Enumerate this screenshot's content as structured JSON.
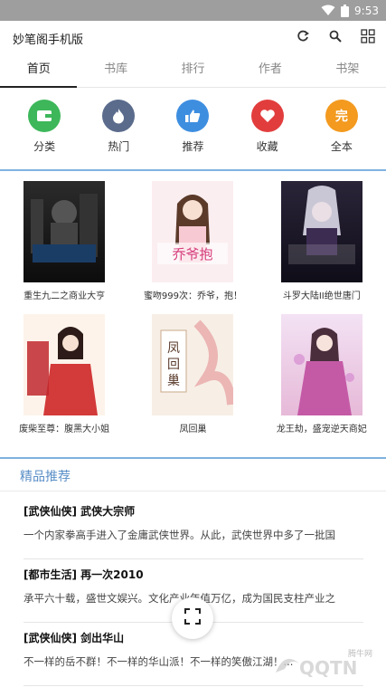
{
  "status_bar": {
    "time": "9:53"
  },
  "app_bar": {
    "title": "妙笔阁手机版"
  },
  "tabs": [
    {
      "label": "首页",
      "active": true
    },
    {
      "label": "书库",
      "active": false
    },
    {
      "label": "排行",
      "active": false
    },
    {
      "label": "作者",
      "active": false
    },
    {
      "label": "书架",
      "active": false
    }
  ],
  "quick_menu": [
    {
      "label": "分类",
      "color": "#3db75a",
      "icon": "wallet-icon"
    },
    {
      "label": "热门",
      "color": "#5a6b8c",
      "icon": "flame-icon"
    },
    {
      "label": "推荐",
      "color": "#3e8ee0",
      "icon": "thumbs-up-icon"
    },
    {
      "label": "收藏",
      "color": "#e23d3d",
      "icon": "heart-icon"
    },
    {
      "label": "全本",
      "color": "#f39a1f",
      "icon_text": "完"
    }
  ],
  "books": [
    {
      "title": "重生九二之商业大亨",
      "cover_text": "重生九二之商业大亨"
    },
    {
      "title": "蜜吻999次：乔爷，抱！",
      "cover_text": "乔爷抱"
    },
    {
      "title": "斗罗大陆II绝世唐门",
      "cover_text": "斗罗大陆II 绝世唐门"
    },
    {
      "title": "废柴至尊：腹黑大小姐",
      "cover_text": "废柴至尊"
    },
    {
      "title": "凤回巢",
      "cover_text": "凤回巢"
    },
    {
      "title": "龙王劫，盛宠逆天商妃",
      "cover_text": "盛宠逆天商妃"
    }
  ],
  "featured": {
    "header": "精品推荐",
    "items": [
      {
        "title": "[武侠仙侠] 武侠大宗师",
        "desc": "一个内家拳高手进入了金庸武侠世界。从此，武侠世界中多了一批国"
      },
      {
        "title": "[都市生活] 再一次2010",
        "desc": "承平六十载，盛世文娱兴。文化产业年值万亿，成为国民支柱产业之"
      },
      {
        "title": "[武侠仙侠] 剑出华山",
        "desc": "不一样的岳不群！不一样的华山派！不一样的笑傲江湖！..."
      }
    ]
  },
  "watermark": {
    "text": "QQTN",
    "sub": "腾牛网"
  }
}
